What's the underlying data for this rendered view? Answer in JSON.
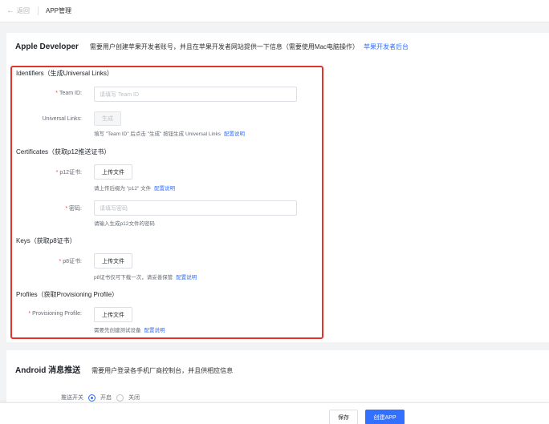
{
  "header": {
    "back_label": "返回",
    "title": "APP管理"
  },
  "apple": {
    "title": "Apple Developer",
    "description": "需要用户创建苹果开发者账号，并且在苹果开发者网站提供一下信息（需要使用Mac电脑操作）",
    "link": "苹果开发者后台",
    "identifiers": {
      "heading": "Identifiers（生成Universal Links）",
      "team_id_label": "Team ID:",
      "team_id_placeholder": "请填写 Team ID",
      "universal_links_label": "Universal Links:",
      "generate_button": "生成",
      "universal_hint": "填写 \"Team ID\" 后点击 \"生成\" 按钮生成 Universal Links",
      "universal_hint_link": "配置说明"
    },
    "certificates": {
      "heading": "Certificates（获取p12推送证书）",
      "p12_label": "p12证书:",
      "upload_button": "上传文件",
      "p12_hint": "请上传后缀为 \"p12\" 文件",
      "p12_hint_link": "配置说明",
      "password_label": "密码:",
      "password_placeholder": "请填写密码",
      "password_hint": "请输入生成p12文件的密码"
    },
    "keys": {
      "heading": "Keys（获取p8证书）",
      "p8_label": "p8证书:",
      "upload_button": "上传文件",
      "p8_hint": "p8证书仅可下载一次，请妥善保管",
      "p8_hint_link": "配置说明"
    },
    "profiles": {
      "heading": "Profiles（获取Provisioning Profile）",
      "profile_label": "Provisioning Profile:",
      "upload_button": "上传文件",
      "profile_hint": "需要先创建测试设备",
      "profile_hint_link": "配置说明"
    }
  },
  "android": {
    "title": "Android 消息推送",
    "description": "需要用户登录各手机厂商控制台，并且供相应信息",
    "row_label": "推送开关",
    "option_on": "开启",
    "option_off": "关闭"
  },
  "footer": {
    "save_label": "保存",
    "create_label": "创建APP"
  },
  "colors": {
    "accent": "#3370ff",
    "highlight_border": "#e5332a",
    "required": "#f54a45"
  }
}
